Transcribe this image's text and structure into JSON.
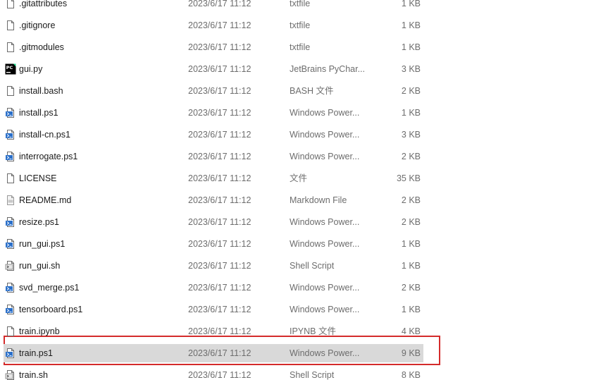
{
  "files": [
    {
      "name": ".gitattributes",
      "date": "2023/6/17 11:12",
      "type": "txtfile",
      "size": "1 KB",
      "icon": "blank-file-icon"
    },
    {
      "name": ".gitignore",
      "date": "2023/6/17 11:12",
      "type": "txtfile",
      "size": "1 KB",
      "icon": "blank-file-icon"
    },
    {
      "name": ".gitmodules",
      "date": "2023/6/17 11:12",
      "type": "txtfile",
      "size": "1 KB",
      "icon": "blank-file-icon"
    },
    {
      "name": "gui.py",
      "date": "2023/6/17 11:12",
      "type": "JetBrains PyChar...",
      "size": "3 KB",
      "icon": "pycharm-icon"
    },
    {
      "name": "install.bash",
      "date": "2023/6/17 11:12",
      "type": "BASH 文件",
      "size": "2 KB",
      "icon": "blank-file-icon"
    },
    {
      "name": "install.ps1",
      "date": "2023/6/17 11:12",
      "type": "Windows Power...",
      "size": "1 KB",
      "icon": "powershell-file-icon"
    },
    {
      "name": "install-cn.ps1",
      "date": "2023/6/17 11:12",
      "type": "Windows Power...",
      "size": "3 KB",
      "icon": "powershell-file-icon"
    },
    {
      "name": "interrogate.ps1",
      "date": "2023/6/17 11:12",
      "type": "Windows Power...",
      "size": "2 KB",
      "icon": "powershell-file-icon"
    },
    {
      "name": "LICENSE",
      "date": "2023/6/17 11:12",
      "type": "文件",
      "size": "35 KB",
      "icon": "blank-file-icon"
    },
    {
      "name": "README.md",
      "date": "2023/6/17 11:12",
      "type": "Markdown File",
      "size": "2 KB",
      "icon": "markdown-file-icon"
    },
    {
      "name": "resize.ps1",
      "date": "2023/6/17 11:12",
      "type": "Windows Power...",
      "size": "2 KB",
      "icon": "powershell-file-icon"
    },
    {
      "name": "run_gui.ps1",
      "date": "2023/6/17 11:12",
      "type": "Windows Power...",
      "size": "1 KB",
      "icon": "powershell-file-icon"
    },
    {
      "name": "run_gui.sh",
      "date": "2023/6/17 11:12",
      "type": "Shell Script",
      "size": "1 KB",
      "icon": "shell-script-icon"
    },
    {
      "name": "svd_merge.ps1",
      "date": "2023/6/17 11:12",
      "type": "Windows Power...",
      "size": "2 KB",
      "icon": "powershell-file-icon"
    },
    {
      "name": "tensorboard.ps1",
      "date": "2023/6/17 11:12",
      "type": "Windows Power...",
      "size": "1 KB",
      "icon": "powershell-file-icon"
    },
    {
      "name": "train.ipynb",
      "date": "2023/6/17 11:12",
      "type": "IPYNB 文件",
      "size": "4 KB",
      "icon": "blank-file-icon"
    },
    {
      "name": "train.ps1",
      "date": "2023/6/17 11:12",
      "type": "Windows Power...",
      "size": "9 KB",
      "icon": "powershell-file-icon",
      "selected": true
    },
    {
      "name": "train.sh",
      "date": "2023/6/17 11:12",
      "type": "Shell Script",
      "size": "8 KB",
      "icon": "shell-script-icon"
    }
  ],
  "colors": {
    "selection": "#d9d9d9",
    "highlight_border": "#d42b2b",
    "secondary_text": "#6d6d6d"
  }
}
